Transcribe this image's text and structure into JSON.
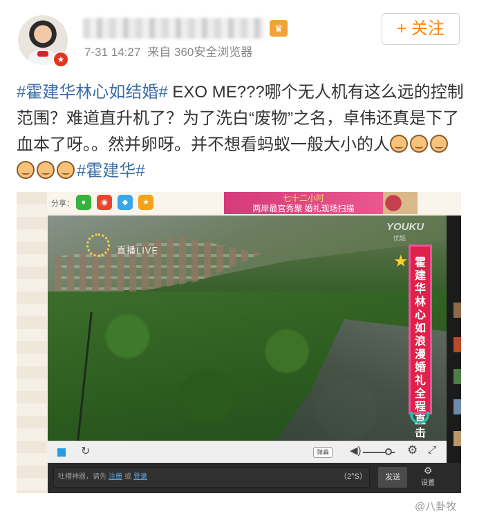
{
  "author": {
    "time": "7-31 14:27",
    "source": "来自 360安全浏览器",
    "follow_label": "+ 关注",
    "verified_badge": "v-badge-icon"
  },
  "post": {
    "hashtag1": "#霍建华林心如结婚#",
    "text": " EXO ME???哪个无人机有这么远的控制范围？难道直升机了？为了洗白“废物”之名，卓伟还真是下了血本了呀。。然并卵呀。并不想看蚂蚁一般大小的人",
    "emoji_count": 6,
    "hashtag2": "#霍建华#"
  },
  "screenshot": {
    "share_label": "分享：",
    "banner_line1": "七十二小时",
    "banner_line2": "两岸最宫秀聚 婚礼现场扫描",
    "live_label": "直播LIVE",
    "youku": "YOUKU",
    "youku_sub": "优酷",
    "ribbon_text": "霍建华林心如浪漫婚礼全程直击",
    "bullet_toggle": "弹幕",
    "danmu_placeholder_prefix": "吐槽神器，请先",
    "danmu_login": "注册",
    "danmu_or": "或",
    "danmu_register": "登录",
    "char_count": "（2°S）",
    "send_label": "发送",
    "settings_label": "设置"
  },
  "watermark": "@八卦牧"
}
